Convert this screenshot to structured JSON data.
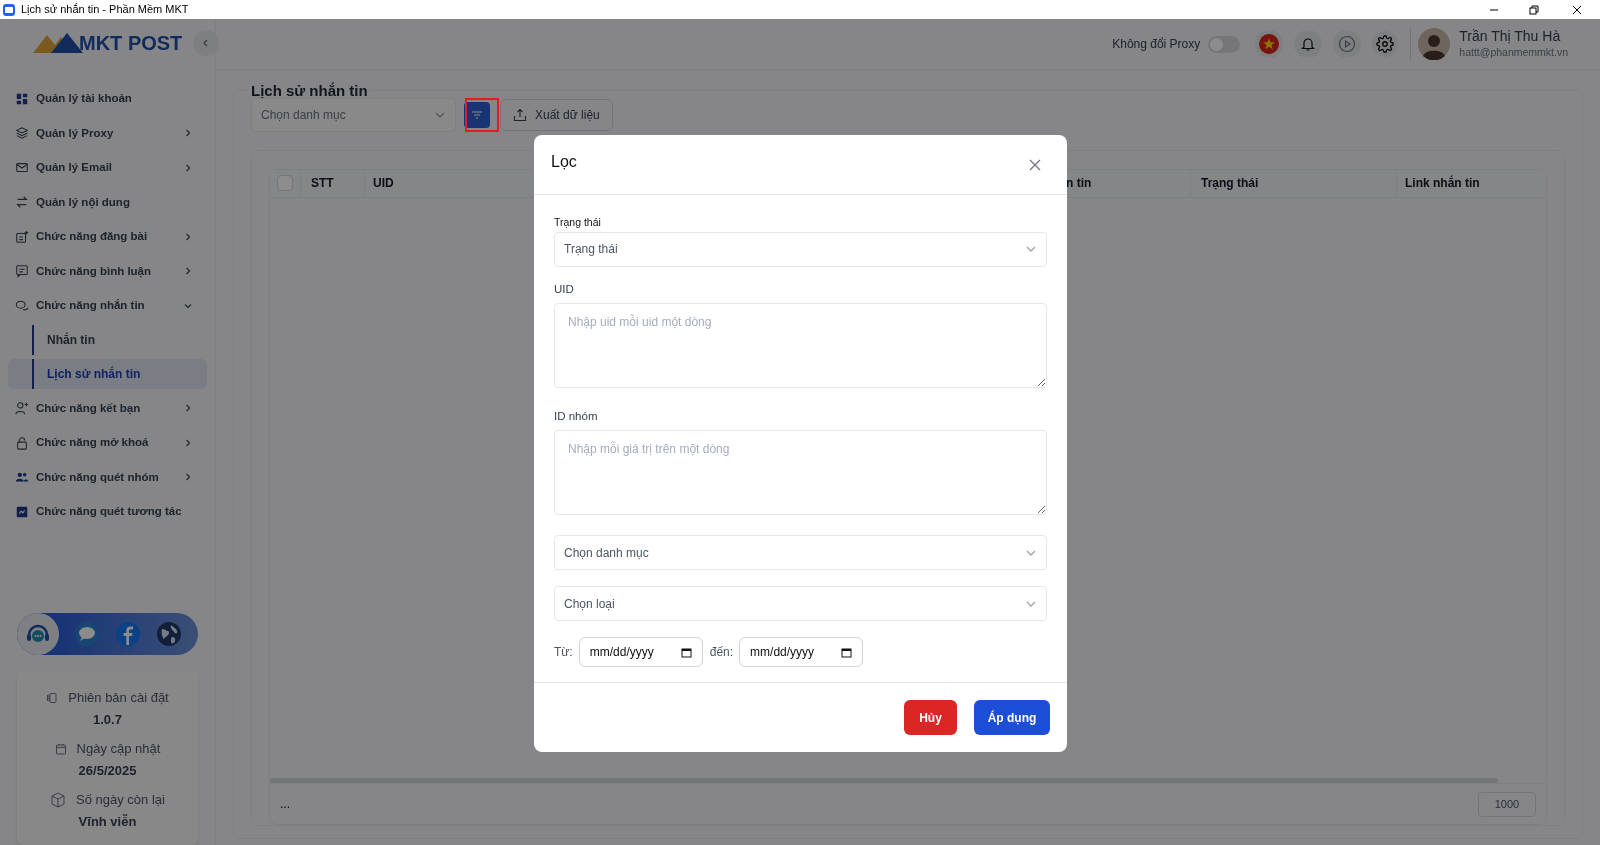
{
  "window": {
    "title": "Lịch sử nhắn tin - Phần Mềm MKT"
  },
  "sidebar": {
    "logo": "MKT POST",
    "items": [
      {
        "label": "Quản lý tài khoản",
        "kind": "link"
      },
      {
        "label": "Quản lý Proxy",
        "kind": "group",
        "expanded": false
      },
      {
        "label": "Quản lý Email",
        "kind": "group",
        "expanded": false
      },
      {
        "label": "Quản lý nội dung",
        "kind": "link"
      },
      {
        "label": "Chức năng đăng bài",
        "kind": "group",
        "expanded": false
      },
      {
        "label": "Chức năng bình luận",
        "kind": "group",
        "expanded": false
      },
      {
        "label": "Chức năng nhắn tin",
        "kind": "group",
        "expanded": true,
        "children": [
          {
            "label": "Nhắn tin",
            "selected": false
          },
          {
            "label": "Lịch sử nhắn tin",
            "selected": true
          }
        ]
      },
      {
        "label": "Chức năng kết bạn",
        "kind": "group",
        "expanded": false
      },
      {
        "label": "Chức năng mở khoá",
        "kind": "group",
        "expanded": false
      },
      {
        "label": "Chức năng quét nhóm",
        "kind": "group",
        "expanded": false
      },
      {
        "label": "Chức năng quét tương tác",
        "kind": "link"
      }
    ],
    "info": [
      {
        "label": "Phiên bản cài đặt",
        "value": "1.0.7"
      },
      {
        "label": "Ngày cập nhật",
        "value": "26/5/2025"
      },
      {
        "label": "Số ngày còn lại",
        "value": "Vĩnh viễn"
      }
    ]
  },
  "header": {
    "proxy_toggle": {
      "label": "Không đổi Proxy",
      "on": false
    },
    "user": {
      "name": "Trần Thị Thu Hà",
      "email": "hattt@phanmemmkt.vn"
    }
  },
  "page": {
    "title": "Lịch sử nhắn tin",
    "category_select": {
      "placeholder": "Chọn danh mục"
    },
    "filter_button": {
      "highlighted": true
    },
    "export_button": "Xuất dữ liệu",
    "table": {
      "select_all_checked": false,
      "columns": [
        {
          "label": "STT"
        },
        {
          "label": "UID"
        },
        {
          "label": "n tin"
        },
        {
          "label": "Trạng thái"
        },
        {
          "label": "Link nhắn tin"
        }
      ],
      "footer_text": "...",
      "page_size": "1000"
    }
  },
  "dialog": {
    "title": "Lọc",
    "status": {
      "label": "Trạng thái",
      "placeholder": "Trạng thái"
    },
    "uid": {
      "label": "UID",
      "placeholder": "Nhập uid mỗi uid một dòng"
    },
    "group_id": {
      "label": "ID nhóm",
      "placeholder": "Nhập mỗi giá trị trên một dòng"
    },
    "category": {
      "placeholder": "Chọn danh mục"
    },
    "type": {
      "placeholder": "Chọn loại"
    },
    "from_label": "Từ:",
    "from_value": "mm/dd/yyyy",
    "to_label": "đến:",
    "to_value": "mm/dd/yyyy",
    "buttons": [
      {
        "label": "Hủy",
        "kind": "cancel"
      },
      {
        "label": "Áp dụng",
        "kind": "apply"
      }
    ]
  }
}
